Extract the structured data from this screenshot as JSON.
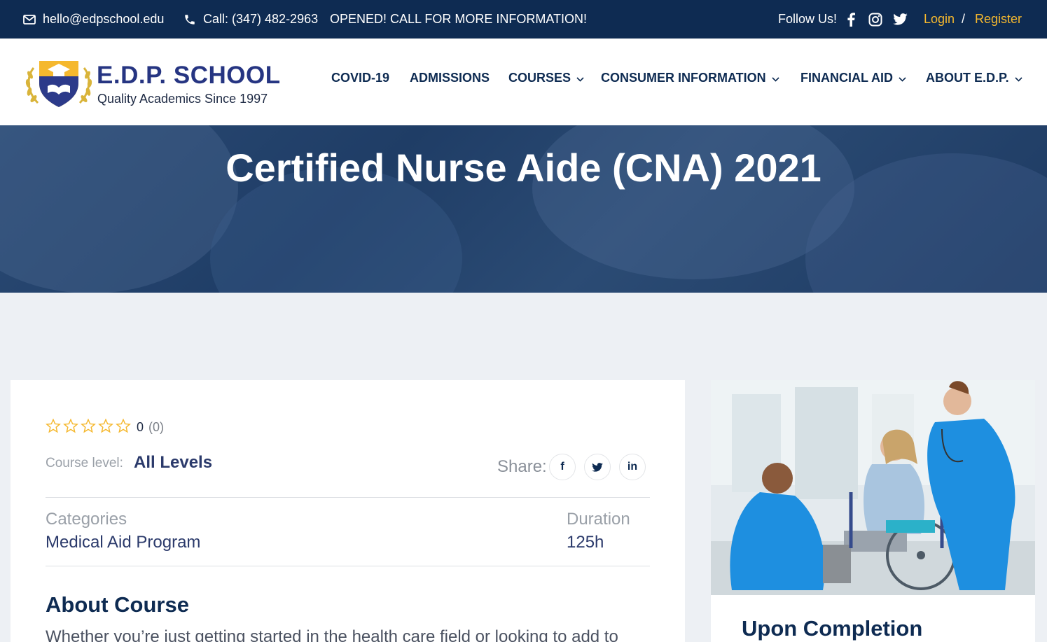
{
  "topbar": {
    "email": "hello@edpschool.edu",
    "phone": "Call: (347) 482-2963",
    "notice": "OPENED! CALL FOR MORE INFORMATION!",
    "follow": "Follow Us!",
    "login": "Login",
    "separator": "/",
    "register": "Register",
    "icons": [
      "mail-icon",
      "phone-icon",
      "facebook-icon",
      "instagram-icon",
      "twitter-icon"
    ]
  },
  "header": {
    "brand": "E.D.P. SCHOOL",
    "tagline": "Quality Academics Since 1997",
    "nav": [
      {
        "label": "COVID-19",
        "dropdown": false
      },
      {
        "label": "ADMISSIONS",
        "dropdown": false
      },
      {
        "label": "COURSES",
        "dropdown": true
      },
      {
        "label": "CONSUMER INFORMATION",
        "dropdown": true
      },
      {
        "label": "FINANCIAL AID",
        "dropdown": true
      },
      {
        "label": "ABOUT E.D.P.",
        "dropdown": true
      }
    ]
  },
  "hero": {
    "title": "Certified Nurse Aide (CNA) 2021"
  },
  "course": {
    "rating": "0",
    "rating_count": "(0)",
    "stars_filled": 0,
    "stars_total": 5,
    "level_label": "Course level:",
    "level_value": "All Levels",
    "share_label": "Share:",
    "share_buttons": [
      "f",
      "in"
    ],
    "categories_label": "Categories",
    "categories_value": "Medical Aid Program",
    "duration_label": "Duration",
    "duration_value": "125h",
    "about_title": "About Course",
    "about_text": "Whether you’re just getting started in the health care field or looking to add to"
  },
  "sidebar": {
    "title": "Upon Completion"
  },
  "colors": {
    "navy": "#0e2b52",
    "accent_gold": "#f5b82e",
    "brand_blue": "#263582",
    "star": "#f5b82e"
  }
}
